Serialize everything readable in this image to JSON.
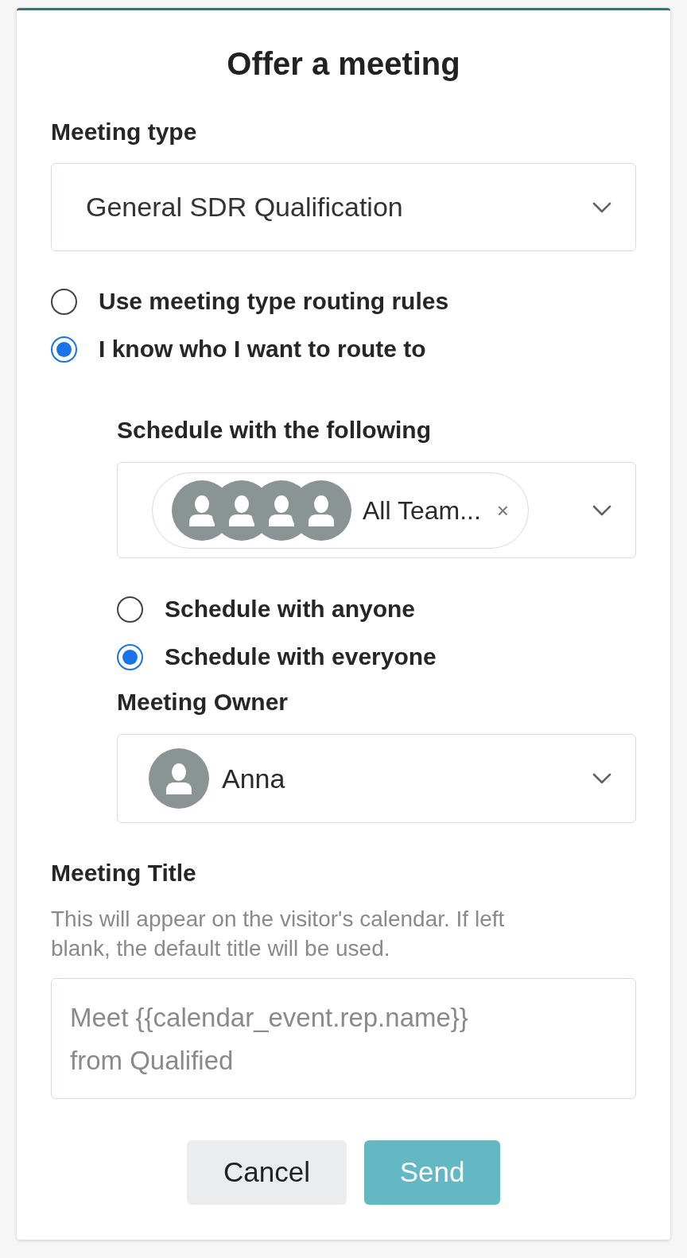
{
  "dialog": {
    "title": "Offer a meeting"
  },
  "meeting_type": {
    "label": "Meeting type",
    "value": "General SDR Qualification"
  },
  "routing_options": [
    {
      "label": "Use meeting type routing rules",
      "selected": false
    },
    {
      "label": "I know who I want to route to",
      "selected": true
    }
  ],
  "schedule_with": {
    "label": "Schedule with the following",
    "chips": [
      {
        "label": "All Team...",
        "remove": "×",
        "avatars": [
          {
            "kind": "person"
          },
          {
            "kind": "person"
          },
          {
            "kind": "person"
          },
          {
            "kind": "person"
          }
        ]
      }
    ]
  },
  "schedule_modes": [
    {
      "label": "Schedule with anyone",
      "selected": false
    },
    {
      "label": "Schedule with everyone",
      "selected": true
    }
  ],
  "meeting_owner": {
    "label": "Meeting Owner",
    "value": "Anna",
    "avatar": {
      "kind": "person"
    }
  },
  "meeting_title": {
    "label": "Meeting Title",
    "help": "This will appear on the visitor's calendar. If left blank, the default title will be used.",
    "placeholder": "Meet {{calendar_event.rep.name}} from Qualified"
  },
  "buttons": [
    {
      "label": "Cancel",
      "kind": "secondary"
    },
    {
      "label": "Send",
      "kind": "primary"
    }
  ]
}
